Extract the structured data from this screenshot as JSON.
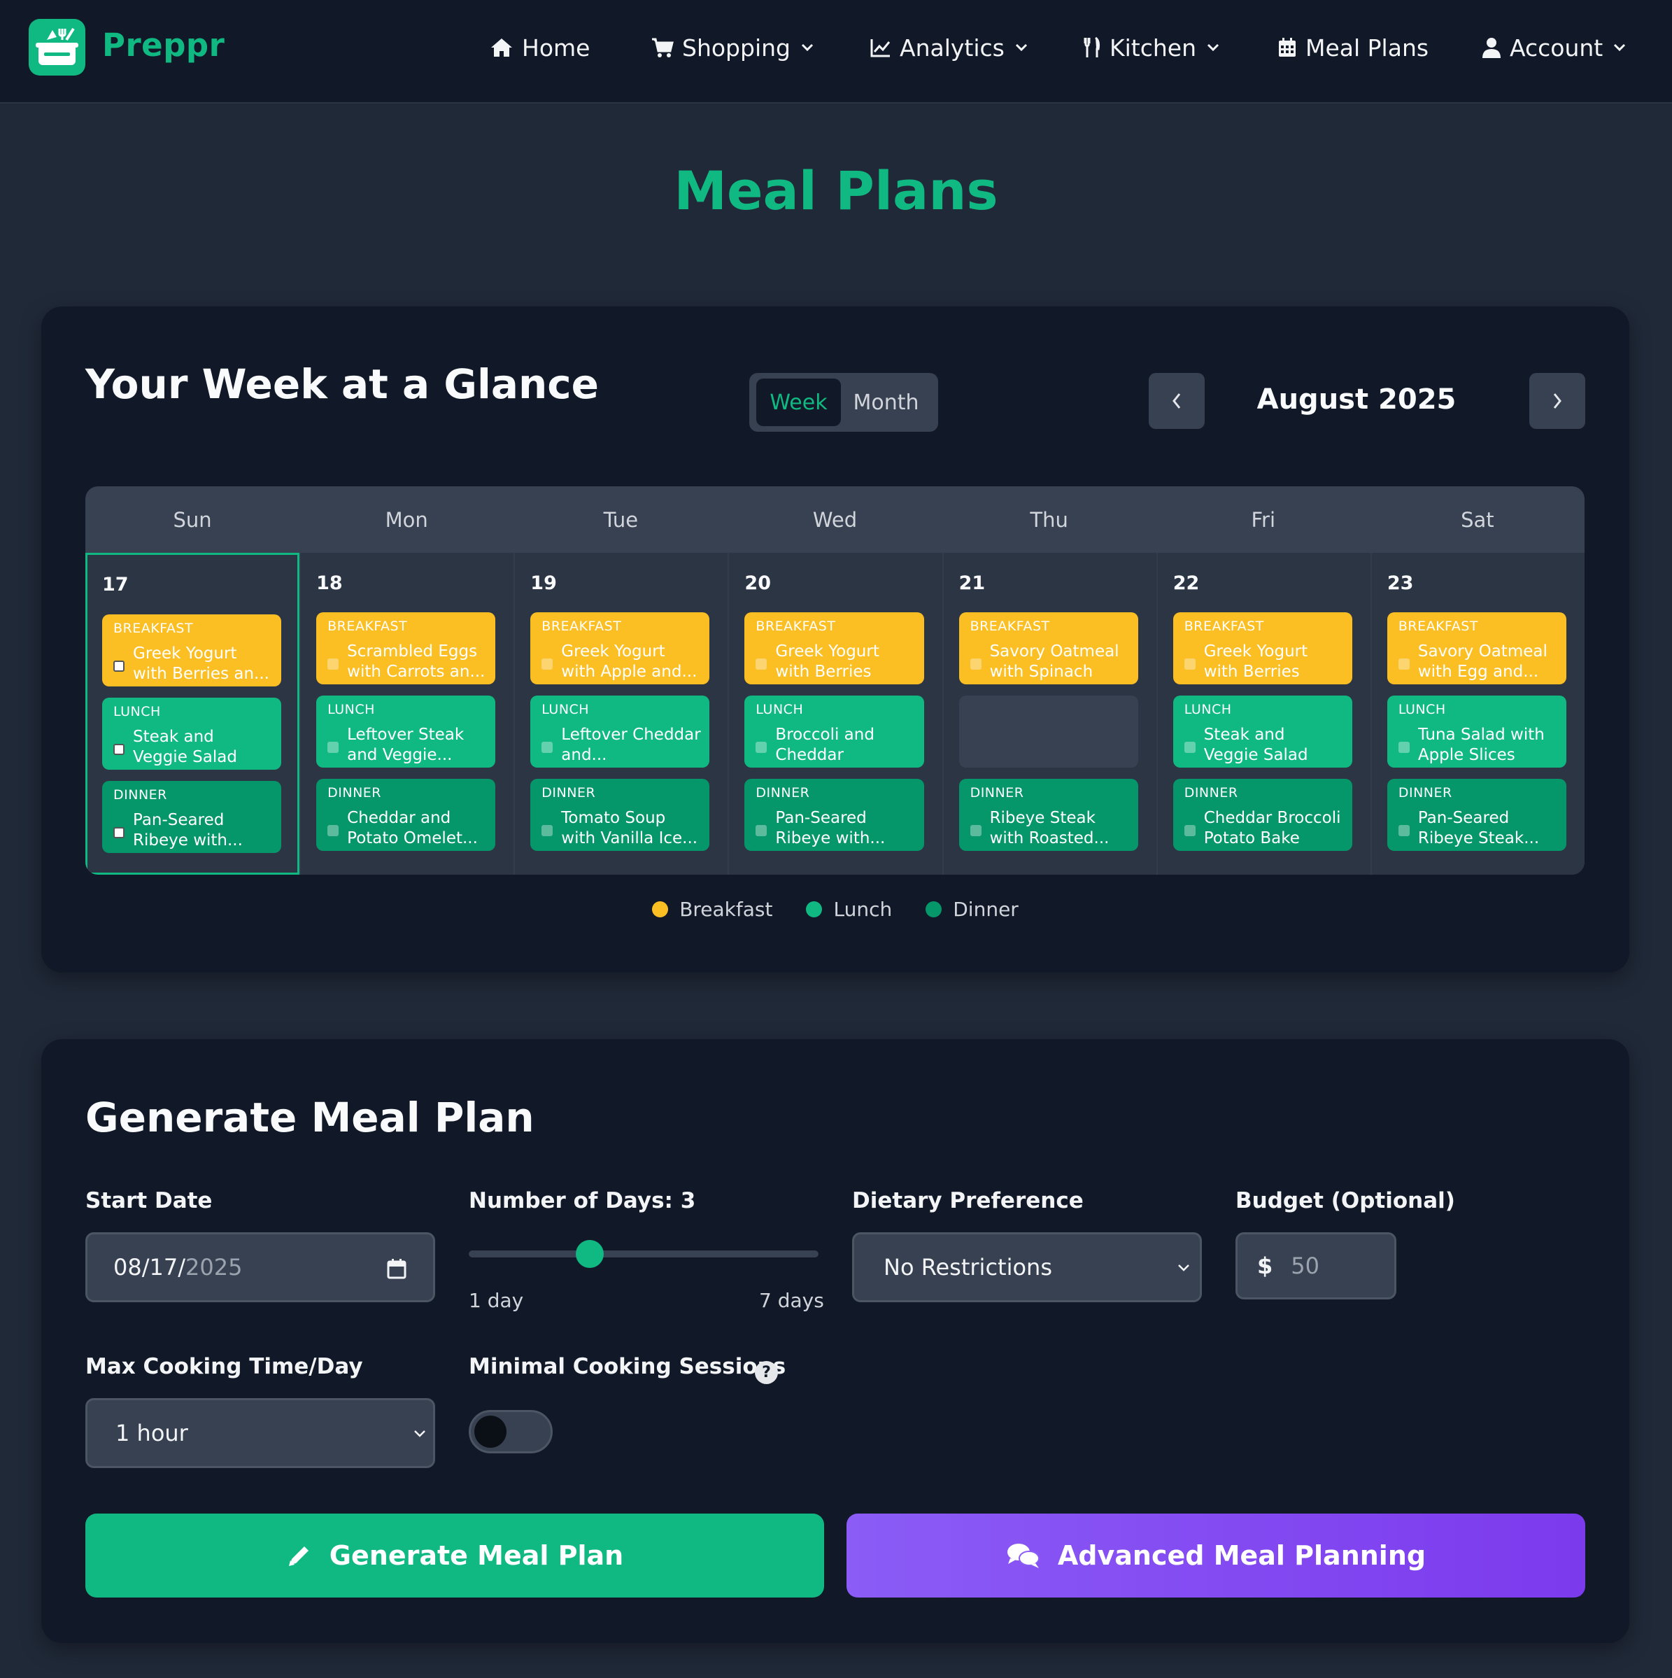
{
  "nav": {
    "brand": "Preppr",
    "items": [
      {
        "label": "Home"
      },
      {
        "label": "Shopping"
      },
      {
        "label": "Analytics"
      },
      {
        "label": "Kitchen"
      },
      {
        "label": "Meal Plans"
      },
      {
        "label": "Account"
      }
    ]
  },
  "page_title": "Meal Plans",
  "week": {
    "title": "Your Week at a Glance",
    "toggle_week": "Week",
    "toggle_month": "Month",
    "month_label": "August 2025",
    "weekdays": [
      "Sun",
      "Mon",
      "Tue",
      "Wed",
      "Thu",
      "Fri",
      "Sat"
    ],
    "days": [
      {
        "num": "17",
        "breakfast": "Greek Yogurt with Berries an...",
        "lunch": "Steak and Veggie Salad",
        "dinner": "Pan-Seared Ribeye with..."
      },
      {
        "num": "18",
        "breakfast": "Scrambled Eggs with Carrots an...",
        "lunch": "Leftover Steak and Veggie...",
        "dinner": "Cheddar and Potato Omelet..."
      },
      {
        "num": "19",
        "breakfast": "Greek Yogurt with Apple and...",
        "lunch": "Leftover Cheddar and...",
        "dinner": "Tomato Soup with Vanilla Ice..."
      },
      {
        "num": "20",
        "breakfast": "Greek Yogurt with Berries and...",
        "lunch": "Broccoli and Cheddar Quiche...",
        "dinner": "Pan-Seared Ribeye with..."
      },
      {
        "num": "21",
        "breakfast": "Savory Oatmeal with Spinach an...",
        "lunch": "",
        "dinner": "Ribeye Steak with Roasted..."
      },
      {
        "num": "22",
        "breakfast": "Greek Yogurt with Berries and...",
        "lunch": "Steak and Veggie Salad",
        "dinner": "Cheddar Broccoli Potato Bake"
      },
      {
        "num": "23",
        "breakfast": "Savory Oatmeal with Egg and...",
        "lunch": "Tuna Salad with Apple Slices",
        "dinner": "Pan-Seared Ribeye Steak..."
      }
    ],
    "meal_labels": {
      "breakfast": "BREAKFAST",
      "lunch": "LUNCH",
      "dinner": "DINNER"
    },
    "legend": [
      "Breakfast",
      "Lunch",
      "Dinner"
    ]
  },
  "colors": {
    "accent": "#10b981",
    "breakfast": "#fbbf24",
    "lunch": "#10b981",
    "dinner": "#059669",
    "advanced": "#8b5cf6"
  },
  "generate": {
    "title": "Generate Meal Plan",
    "start_date_label": "Start Date",
    "start_date_value": "08/17/",
    "start_date_year": "2025",
    "days_label": "Number of Days: 3",
    "days_value": 3,
    "days_min_label": "1 day",
    "days_max_label": "7 days",
    "dietary_label": "Dietary Preference",
    "dietary_value": "No Restrictions",
    "budget_label": "Budget (Optional)",
    "budget_symbol": "$",
    "budget_placeholder": "50",
    "max_time_label": "Max Cooking Time/Day",
    "max_time_value": "1 hour",
    "minimal_sessions_label": "Minimal Cooking Sessions",
    "minimal_sessions_on": false,
    "help_symbol": "?",
    "generate_button": "Generate Meal Plan",
    "advanced_button": "Advanced Meal Planning"
  }
}
